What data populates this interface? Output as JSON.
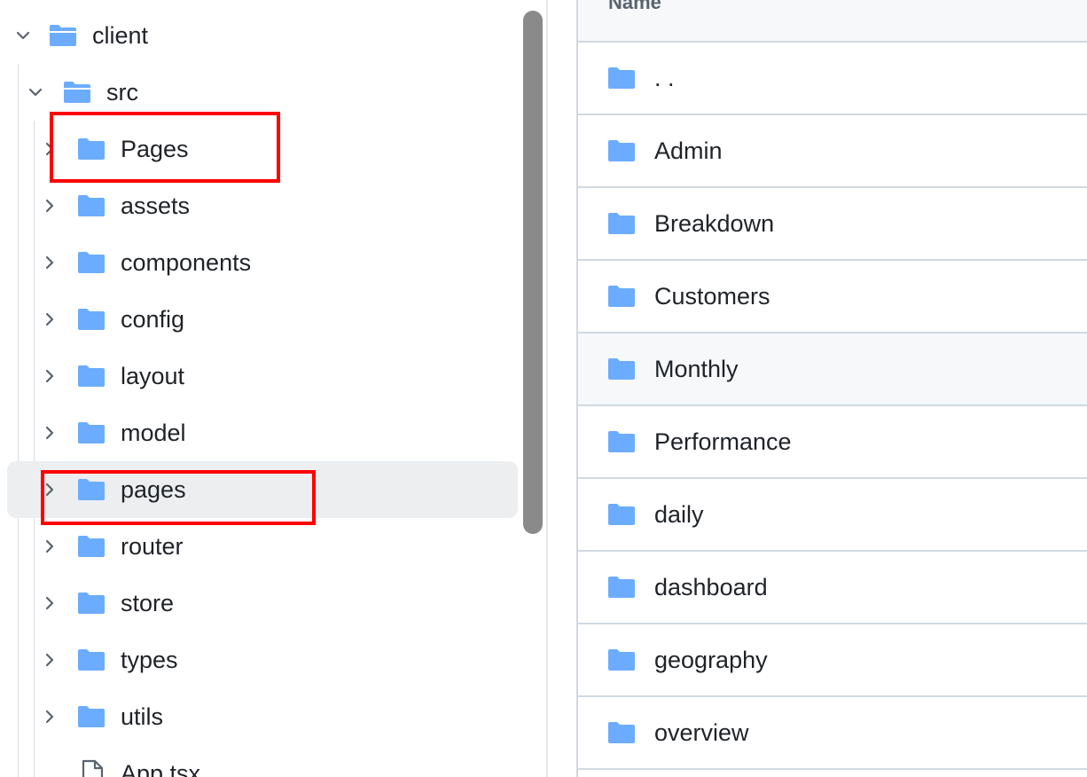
{
  "tree": {
    "root": {
      "label": "client",
      "expanded": true
    },
    "src": {
      "label": "src",
      "expanded": true
    },
    "items": [
      {
        "label": "Pages",
        "type": "folder"
      },
      {
        "label": "assets",
        "type": "folder"
      },
      {
        "label": "components",
        "type": "folder"
      },
      {
        "label": "config",
        "type": "folder"
      },
      {
        "label": "layout",
        "type": "folder"
      },
      {
        "label": "model",
        "type": "folder"
      },
      {
        "label": "pages",
        "type": "folder",
        "hovered": true
      },
      {
        "label": "router",
        "type": "folder"
      },
      {
        "label": "store",
        "type": "folder"
      },
      {
        "label": "types",
        "type": "folder"
      },
      {
        "label": "utils",
        "type": "folder"
      },
      {
        "label": "App.tsx",
        "type": "file"
      }
    ]
  },
  "table": {
    "header": "Name",
    "rows": [
      {
        "label": ". ."
      },
      {
        "label": "Admin"
      },
      {
        "label": "Breakdown"
      },
      {
        "label": "Customers"
      },
      {
        "label": "Monthly",
        "hovered": true
      },
      {
        "label": "Performance"
      },
      {
        "label": "daily"
      },
      {
        "label": "dashboard"
      },
      {
        "label": "geography"
      },
      {
        "label": "overview"
      }
    ]
  },
  "colors": {
    "folder": "#6cacff",
    "annotation": "#ff0000",
    "hover_row": "#eceef0"
  },
  "icons": {
    "folder": "folder-icon",
    "file": "file-icon",
    "chevron_right": "chevron-right-icon",
    "chevron_down": "chevron-down-icon"
  }
}
